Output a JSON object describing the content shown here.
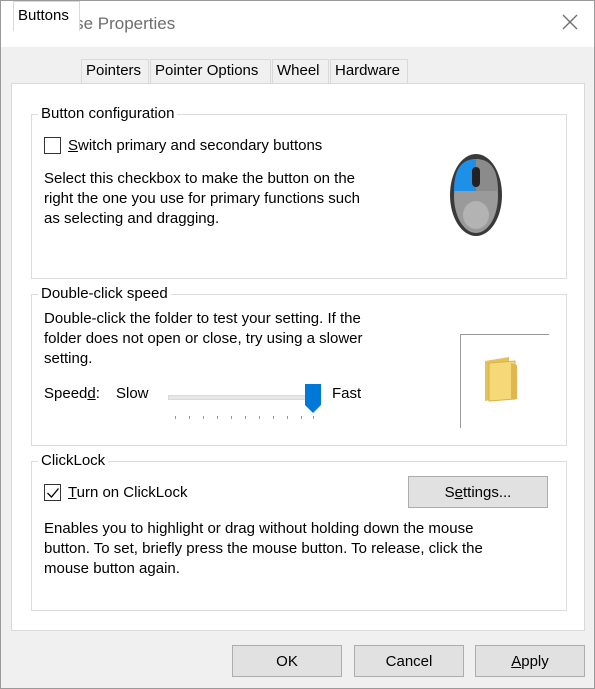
{
  "window": {
    "title": "Mouse Properties",
    "icon": "mouse-app-icon",
    "accent": "#0078d7"
  },
  "tabs": [
    {
      "label": "Buttons",
      "active": true
    },
    {
      "label": "Pointers",
      "active": false
    },
    {
      "label": "Pointer Options",
      "active": false
    },
    {
      "label": "Wheel",
      "active": false
    },
    {
      "label": "Hardware",
      "active": false
    }
  ],
  "button_config": {
    "title": "Button configuration",
    "switch_label_first": "S",
    "switch_label_rest": "witch primary and secondary buttons",
    "switch_checked": false,
    "description_lines": [
      "Select this checkbox to make the button on the",
      "right the one you use for primary functions such",
      "as selecting and dragging."
    ]
  },
  "double_click": {
    "title": "Double-click speed",
    "description_lines": [
      "Double-click the folder to test your setting. If the",
      "folder does not open or close, try using a slower",
      "setting."
    ],
    "speed_label_start": "Speed",
    "speed_label_accel": "d",
    "speed_label_end": ":",
    "slow_label": "Slow",
    "fast_label": "Fast",
    "slider_value": 1.0,
    "folder_icon": "folder-icon"
  },
  "clicklock": {
    "title": "ClickLock",
    "turn_on_first": "T",
    "turn_on_rest": "urn on ClickLock",
    "checked": true,
    "settings_button_start": "S",
    "settings_button_accel": "e",
    "settings_button_end": "ttings...",
    "description_lines": [
      "Enables you to highlight or drag without holding down the mouse",
      "button. To set, briefly press the mouse button. To release, click the",
      "mouse button again."
    ]
  },
  "footer": {
    "ok_label": "OK",
    "cancel_label": "Cancel",
    "apply_first": "A",
    "apply_rest": "pply"
  }
}
